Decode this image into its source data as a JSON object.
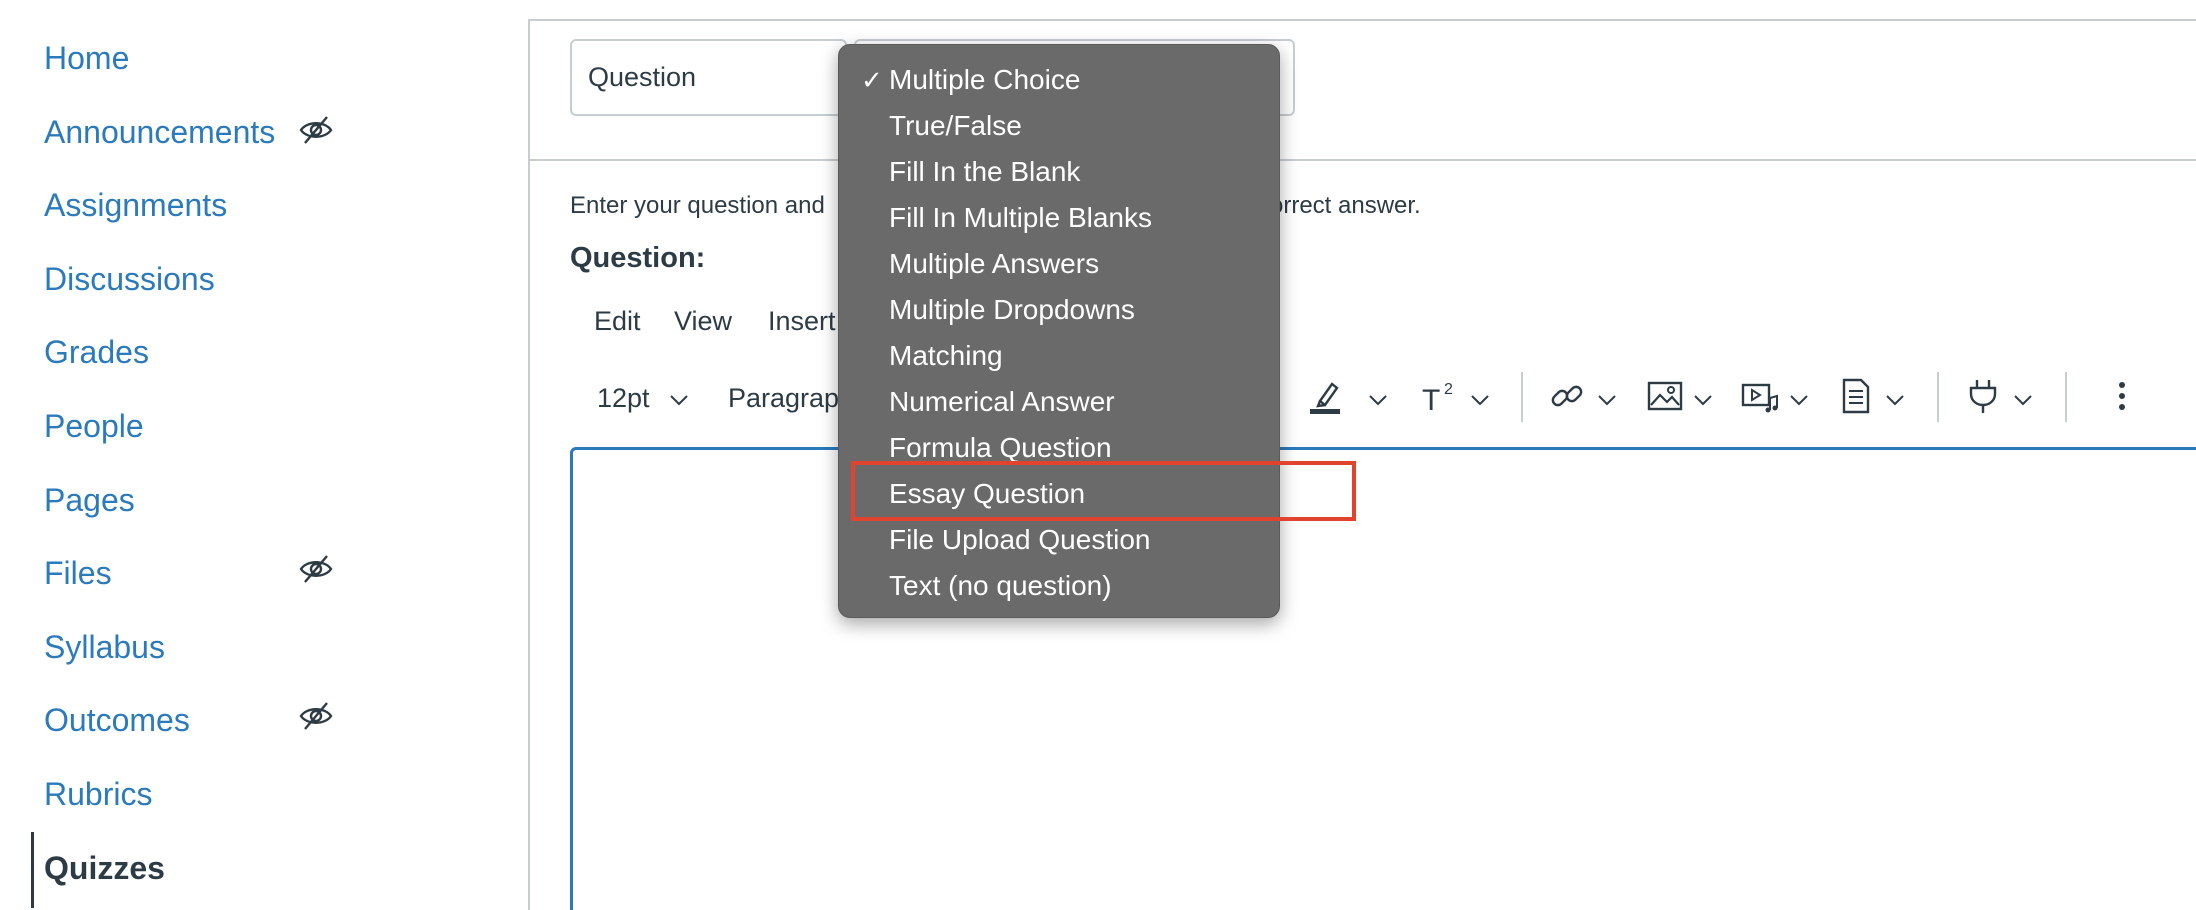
{
  "course_nav": {
    "items": [
      {
        "label": "Home",
        "hidden_from_students": false,
        "active": false
      },
      {
        "label": "Announcements",
        "hidden_from_students": true,
        "active": false
      },
      {
        "label": "Assignments",
        "hidden_from_students": false,
        "active": false
      },
      {
        "label": "Discussions",
        "hidden_from_students": false,
        "active": false
      },
      {
        "label": "Grades",
        "hidden_from_students": false,
        "active": false
      },
      {
        "label": "People",
        "hidden_from_students": false,
        "active": false
      },
      {
        "label": "Pages",
        "hidden_from_students": false,
        "active": false
      },
      {
        "label": "Files",
        "hidden_from_students": true,
        "active": false
      },
      {
        "label": "Syllabus",
        "hidden_from_students": false,
        "active": false
      },
      {
        "label": "Outcomes",
        "hidden_from_students": true,
        "active": false
      },
      {
        "label": "Rubrics",
        "hidden_from_students": false,
        "active": false
      },
      {
        "label": "Quizzes",
        "hidden_from_students": false,
        "active": true
      }
    ],
    "hidden_icon": "eye-slash-icon"
  },
  "question_form": {
    "name_value": "Question",
    "instructions_start": "Enter your question and",
    "instructions_end": "orrect answer.",
    "question_label": "Question:"
  },
  "editor": {
    "menubar": [
      "Edit",
      "View",
      "Insert"
    ],
    "font_size": "12pt",
    "block_format": "Paragraph",
    "toolbar_icons": [
      "highlight-color-icon",
      "superscript-icon",
      "link-icon",
      "image-icon",
      "media-icon",
      "document-icon",
      "plugin-icon",
      "more-options-icon"
    ]
  },
  "question_type_menu": {
    "selected": "Multiple Choice",
    "check_mark": "✓",
    "options": [
      "Multiple Choice",
      "True/False",
      "Fill In the Blank",
      "Fill In Multiple Blanks",
      "Multiple Answers",
      "Multiple Dropdowns",
      "Matching",
      "Numerical Answer",
      "Formula Question",
      "Essay Question",
      "File Upload Question",
      "Text (no question)"
    ],
    "highlighted_option": "Essay Question"
  },
  "colors": {
    "link": "#2b7abc",
    "text": "#2d3b45",
    "border": "#c7cdd1",
    "menu_bg": "#6a6a6a",
    "highlight_box": "#e0432e"
  }
}
